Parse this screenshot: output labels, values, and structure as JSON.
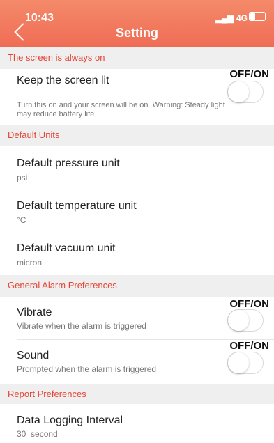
{
  "status": {
    "time": "10:43",
    "network": "4G",
    "battery_level": 0.3
  },
  "header": {
    "title": "Setting"
  },
  "sections": [
    {
      "label": "The screen is always on"
    },
    {
      "label": "Default Units"
    },
    {
      "label": "General Alarm Preferences"
    },
    {
      "label": "Report Preferences"
    }
  ],
  "items": {
    "keep_screen": {
      "label": "Keep the screen lit",
      "description": "Turn this on and your screen will be on. Warning: Steady light may reduce battery life",
      "toggle_label": "OFF/ON",
      "on": false
    },
    "pressure": {
      "label": "Default pressure unit",
      "value": "psi"
    },
    "temperature": {
      "label": "Default temperature unit",
      "value": "°C"
    },
    "vacuum": {
      "label": "Default vacuum unit",
      "value": "micron"
    },
    "vibrate": {
      "label": "Vibrate",
      "description": "Vibrate when the alarm is triggered",
      "toggle_label": "OFF/ON",
      "on": false
    },
    "sound": {
      "label": "Sound",
      "description": "Prompted when the alarm is triggered",
      "toggle_label": "OFF/ON",
      "on": false
    },
    "logging": {
      "label": "Data Logging Interval",
      "value": "30  second"
    }
  }
}
